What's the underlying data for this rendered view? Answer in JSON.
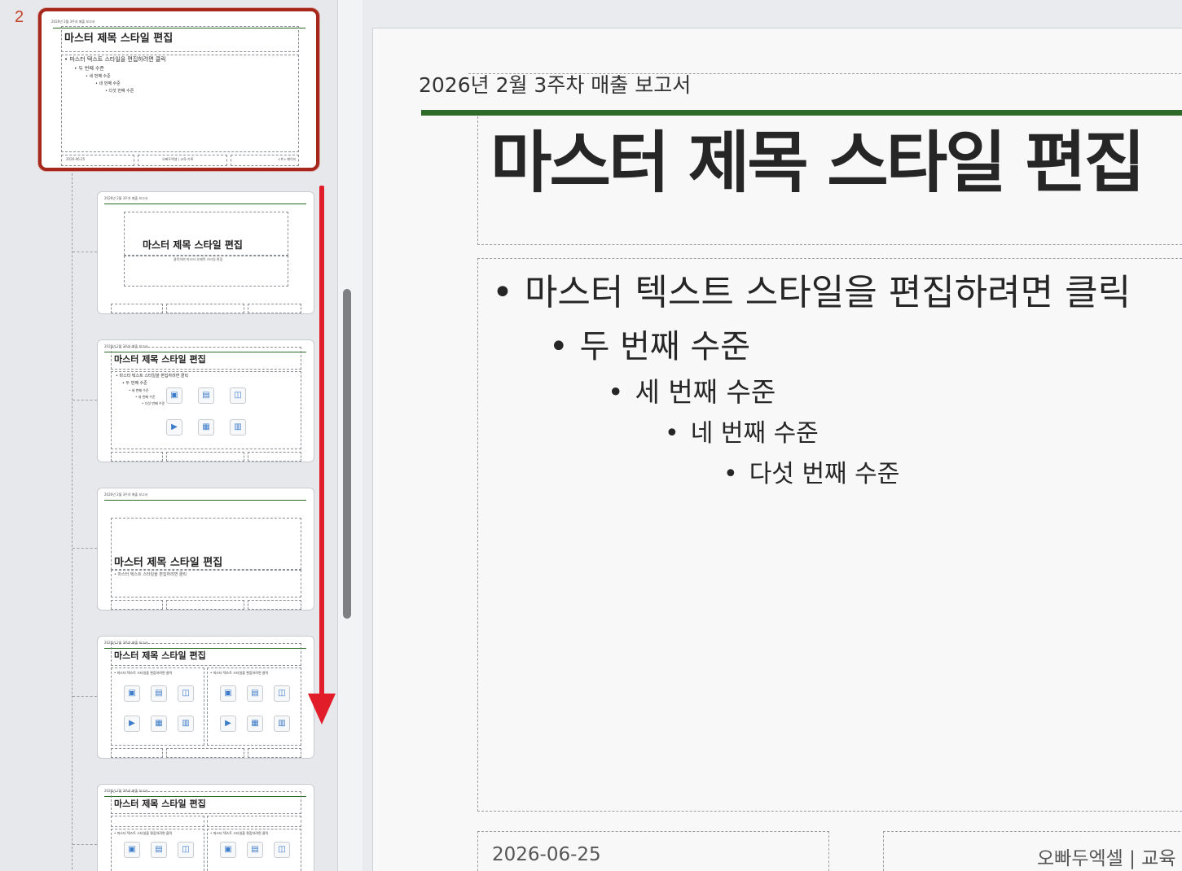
{
  "thumbnails": {
    "slide_number": "2",
    "header": "2026년 2월 3주차 매출 보고서",
    "title": "마스터 제목 스타일 편집",
    "subtitle": "클릭하여 마스터 부제목 스타일 편집",
    "body_l1": "• 마스터 텍스트 스타일을 편집하려면 클릭",
    "body_l2": "• 두 번째 수준",
    "body_l3": "• 세 번째 수준",
    "body_l4": "• 네 번째 수준",
    "body_l5": "• 다섯 번째 수준",
    "footer_date": "2026-06-25",
    "footer_text": "오빠두엑셀 | 교육·기록",
    "footer_page": "<#> 페이지"
  },
  "slide": {
    "header": "2026년 2월 3주차 매출 보고서",
    "title": "마스터 제목 스타일 편집",
    "body": [
      "마스터 텍스트 스타일을 편집하려면 클릭",
      "두 번째 수준",
      "세 번째 수준",
      "네 번째 수준",
      "다섯 번째 수준"
    ],
    "bullet": "•",
    "footer_date": "2026-06-25",
    "footer_text": "오빠두엑셀 | 교육"
  },
  "icons": [
    "insert-picture-icon",
    "insert-smartart-icon",
    "insert-online-picture-icon",
    "insert-video-icon",
    "insert-table-icon",
    "insert-chart-icon"
  ],
  "colors": {
    "selection_border": "#a6281d",
    "accent_green": "#2e6b2b",
    "arrow_red": "#e21d2a",
    "slide_number": "#c2442b"
  }
}
